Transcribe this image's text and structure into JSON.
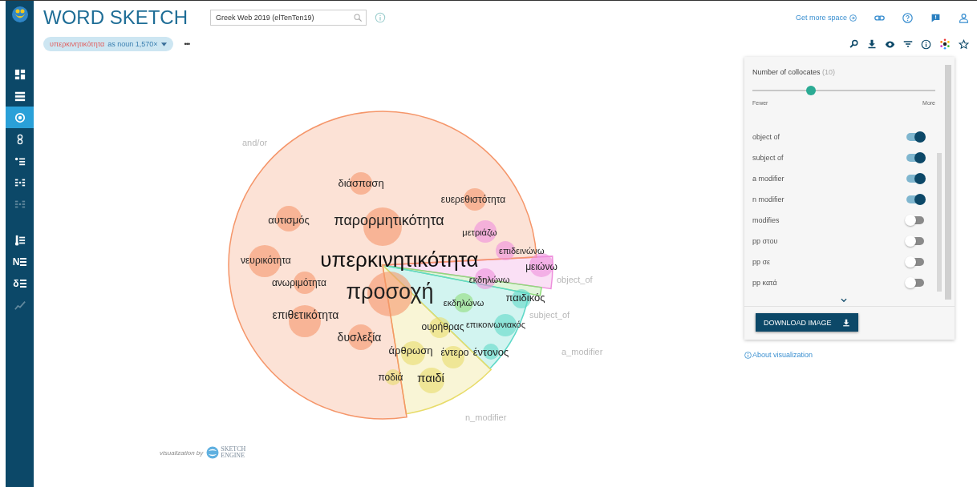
{
  "app": {
    "title": "WORD SKETCH",
    "corpus_field": {
      "value": "Greek Web 2019 (elTenTen19)"
    }
  },
  "sidebar": {
    "items": [
      {
        "selected": false,
        "disabled": false
      },
      {
        "selected": false,
        "disabled": false
      },
      {
        "selected": true,
        "disabled": false
      },
      {
        "selected": false,
        "disabled": false
      },
      {
        "selected": false,
        "disabled": false
      },
      {
        "selected": false,
        "disabled": false
      },
      {
        "selected": false,
        "disabled": true
      },
      {
        "selected": false,
        "disabled": false
      },
      {
        "selected": false,
        "disabled": false,
        "glyph": "N"
      },
      {
        "selected": false,
        "disabled": false,
        "glyph": "δ"
      },
      {
        "selected": false,
        "disabled": true
      }
    ]
  },
  "top_links": {
    "more_space": "Get more space"
  },
  "query_chip": {
    "headword": "υπερκινητικότητα",
    "details": "as noun 1,570×",
    "more": "•••"
  },
  "visualization": {
    "headword": "υπερκινητικότητα",
    "sectors": [
      {
        "label": "object_of",
        "color": "#ee8fdc",
        "words": [
          "μετριάζω",
          "επιδεινώνω",
          "μειώνω",
          "εκδηλώνω"
        ]
      },
      {
        "label": "subject_of",
        "color": "#8fdc7a",
        "words": [
          "εκδηλώνω"
        ]
      },
      {
        "label": "a_modifier",
        "color": "#5fd9c8",
        "words": [
          "παιδικός",
          "επικοινωνιακός",
          "έντονος"
        ]
      },
      {
        "label": "n_modifier",
        "color": "#e8dc6a",
        "words": [
          "ουρήθρας",
          "άρθρωση",
          "έντερο",
          "ποδιά",
          "παιδί"
        ]
      },
      {
        "label": "and/or",
        "color": "#f5966a",
        "words": [
          "διάσπαση",
          "ευερεθιστότητα",
          "αυτισμός",
          "παρορμητικότητα",
          "νευρικότητα",
          "ανωριμότητα",
          "προσοχή",
          "επιθετικότητα",
          "δυσλεξία"
        ]
      }
    ],
    "credit": {
      "text": "visualization by",
      "logo_text": "SKETCH ENGINE"
    }
  },
  "settings_panel": {
    "collocates_label": "Number of collocates",
    "collocates_count": "(10)",
    "slider": {
      "level": 0.32
    },
    "min_label": "Fewer",
    "max_label": "More",
    "relations": [
      {
        "label": "object of",
        "on": true
      },
      {
        "label": "subject of",
        "on": true
      },
      {
        "label": "a modifier",
        "on": true
      },
      {
        "label": "n modifier",
        "on": true
      },
      {
        "label": "modifies",
        "on": false
      },
      {
        "label": "pp στου",
        "on": false
      },
      {
        "label": "pp σε",
        "on": false
      },
      {
        "label": "pp κατά",
        "on": false
      }
    ],
    "download_button": "DOWNLOAD IMAGE"
  },
  "about_link": "About visualization"
}
